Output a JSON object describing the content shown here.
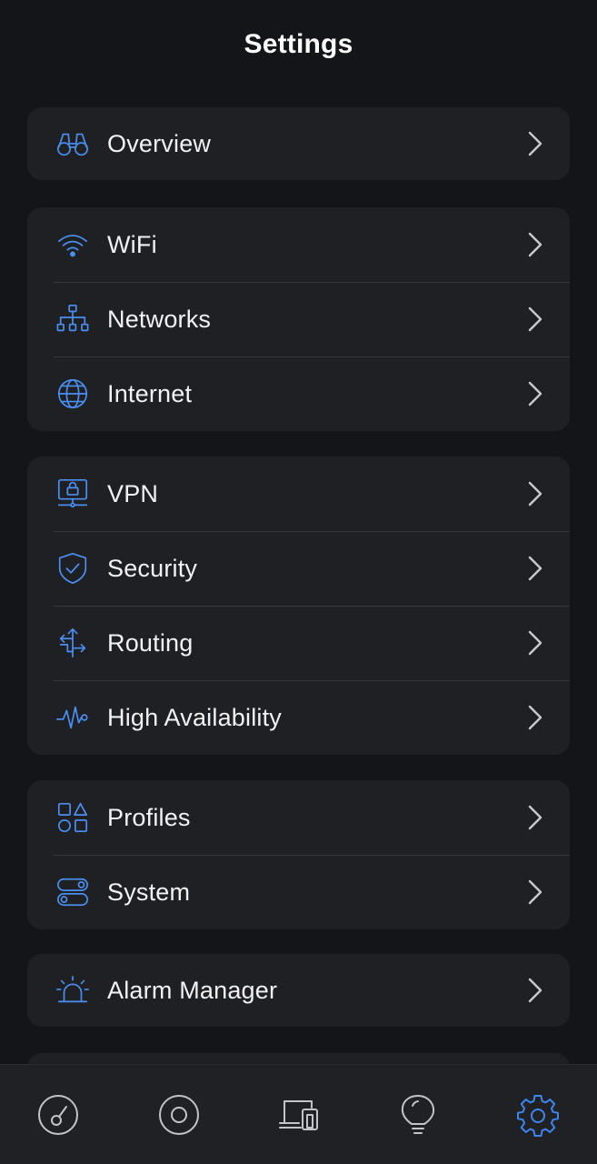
{
  "header": {
    "title": "Settings"
  },
  "groups": [
    {
      "items": [
        {
          "label": "Overview",
          "icon": "binoculars-icon"
        }
      ]
    },
    {
      "items": [
        {
          "label": "WiFi",
          "icon": "wifi-icon"
        },
        {
          "label": "Networks",
          "icon": "network-tree-icon"
        },
        {
          "label": "Internet",
          "icon": "globe-icon"
        }
      ]
    },
    {
      "items": [
        {
          "label": "VPN",
          "icon": "vpn-lock-icon"
        },
        {
          "label": "Security",
          "icon": "shield-check-icon"
        },
        {
          "label": "Routing",
          "icon": "routing-arrows-icon"
        },
        {
          "label": "High Availability",
          "icon": "pulse-icon"
        }
      ]
    },
    {
      "items": [
        {
          "label": "Profiles",
          "icon": "shapes-icon"
        },
        {
          "label": "System",
          "icon": "toggles-icon"
        }
      ]
    },
    {
      "items": [
        {
          "label": "Alarm Manager",
          "icon": "alarm-siren-icon"
        }
      ]
    }
  ],
  "tabbar": {
    "tabs": [
      {
        "name": "dashboard",
        "icon": "speedometer-icon",
        "active": false
      },
      {
        "name": "topology",
        "icon": "target-circle-icon",
        "active": false
      },
      {
        "name": "devices",
        "icon": "devices-icon",
        "active": false
      },
      {
        "name": "insights",
        "icon": "lightbulb-icon",
        "active": false
      },
      {
        "name": "settings",
        "icon": "gear-icon",
        "active": true
      }
    ]
  },
  "colors": {
    "accent": "#4a8ff0",
    "background": "#141518",
    "card": "#1f2024",
    "text": "#f2f2f4"
  }
}
